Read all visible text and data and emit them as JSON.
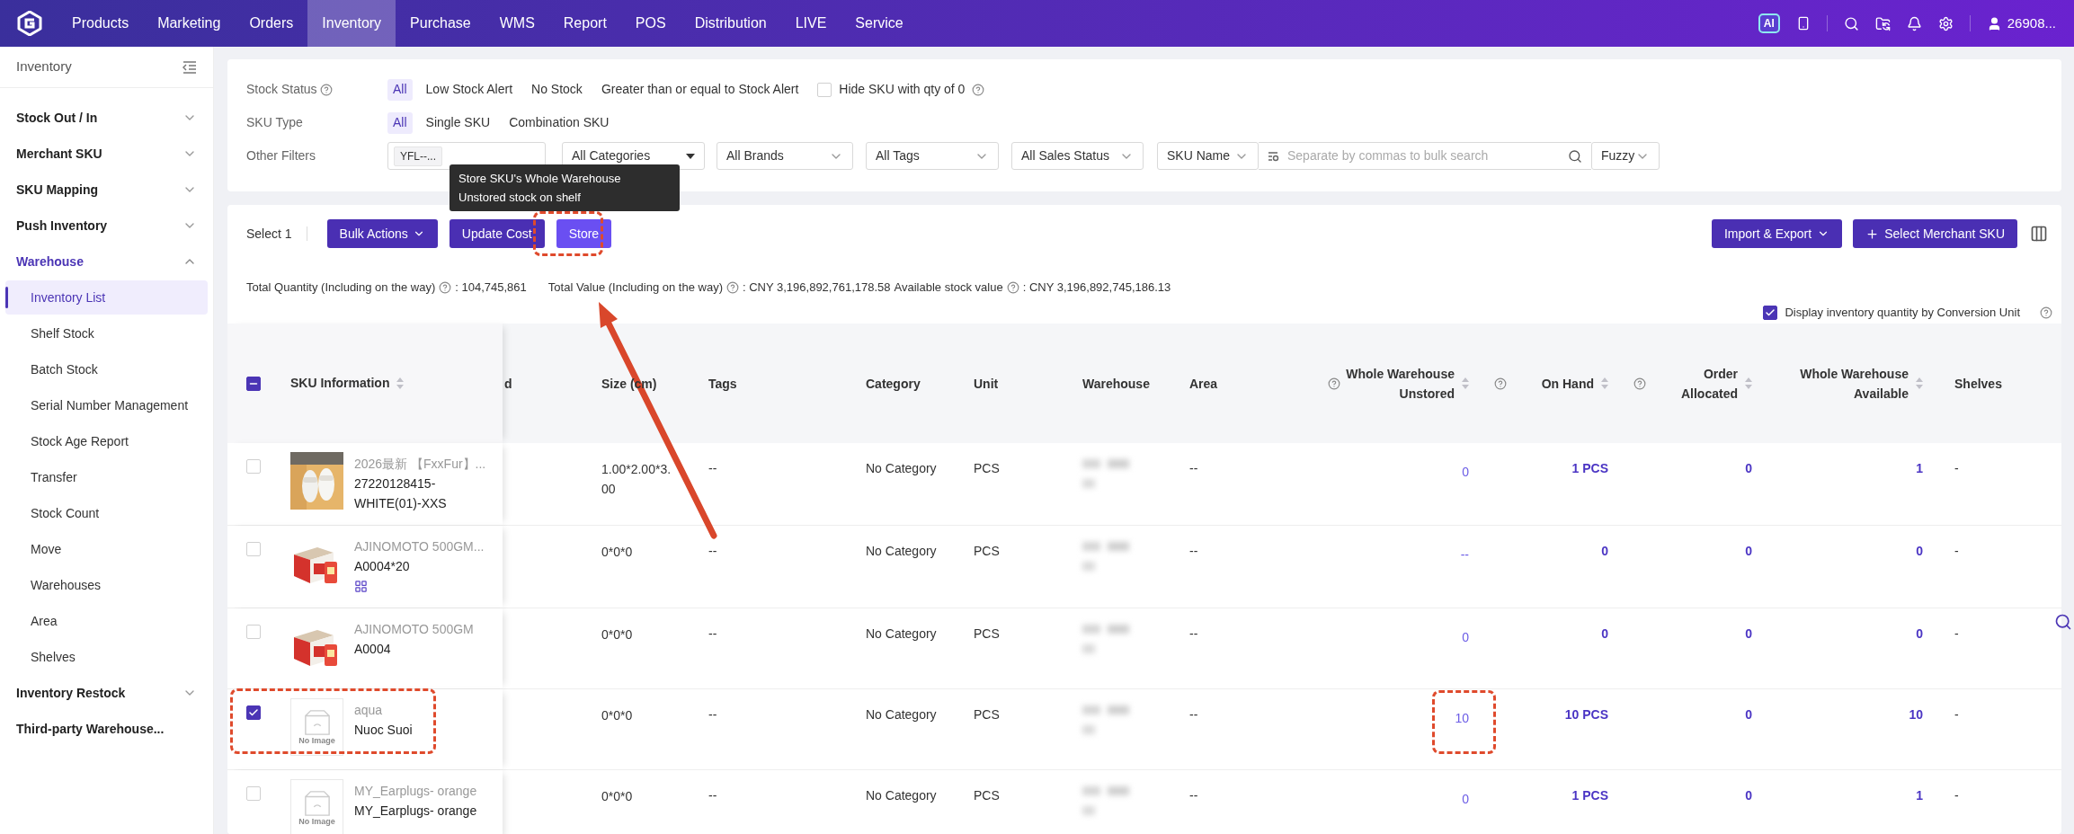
{
  "top_nav": {
    "items": [
      {
        "label": "Products",
        "selected": false
      },
      {
        "label": "Marketing",
        "selected": false
      },
      {
        "label": "Orders",
        "selected": false
      },
      {
        "label": "Inventory",
        "selected": true
      },
      {
        "label": "Purchase",
        "selected": false
      },
      {
        "label": "WMS",
        "selected": false
      },
      {
        "label": "Report",
        "selected": false
      },
      {
        "label": "POS",
        "selected": false
      },
      {
        "label": "Distribution",
        "selected": false
      },
      {
        "label": "LIVE",
        "selected": false
      },
      {
        "label": "Service",
        "selected": false
      }
    ],
    "ai_badge": "AI",
    "user": "26908..."
  },
  "sidebar": {
    "title": "Inventory",
    "groups": [
      {
        "label": "Stock Out / In",
        "expandable": true,
        "expanded": false,
        "selected": false
      },
      {
        "label": "Merchant SKU",
        "expandable": true,
        "expanded": false,
        "selected": false
      },
      {
        "label": "SKU Mapping",
        "expandable": true,
        "expanded": false,
        "selected": false
      },
      {
        "label": "Push Inventory",
        "expandable": true,
        "expanded": false,
        "selected": false
      },
      {
        "label": "Warehouse",
        "expandable": true,
        "expanded": true,
        "selected": true,
        "children": [
          {
            "label": "Inventory List",
            "selected": true
          },
          {
            "label": "Shelf Stock",
            "selected": false
          },
          {
            "label": "Batch Stock",
            "selected": false
          },
          {
            "label": "Serial Number Management",
            "selected": false
          },
          {
            "label": "Stock Age Report",
            "selected": false
          },
          {
            "label": "Transfer",
            "selected": false
          },
          {
            "label": "Stock Count",
            "selected": false
          },
          {
            "label": "Move",
            "selected": false
          },
          {
            "label": "Warehouses",
            "selected": false
          },
          {
            "label": "Area",
            "selected": false
          },
          {
            "label": "Shelves",
            "selected": false
          }
        ]
      },
      {
        "label": "Inventory Restock",
        "expandable": true,
        "expanded": false,
        "selected": false
      },
      {
        "label": "Third-party Warehouse...",
        "expandable": false,
        "expanded": false,
        "selected": false
      }
    ]
  },
  "filters": {
    "stock_status": {
      "label": "Stock Status",
      "options": [
        {
          "label": "All",
          "selected": true
        },
        {
          "label": "Low Stock Alert",
          "selected": false
        },
        {
          "label": "No Stock",
          "selected": false
        },
        {
          "label": "Greater than or equal to Stock Alert",
          "selected": false
        }
      ],
      "hide_zero": {
        "label": "Hide SKU with qty of 0",
        "checked": false
      }
    },
    "sku_type": {
      "label": "SKU Type",
      "options": [
        {
          "label": "All",
          "selected": true
        },
        {
          "label": "Single SKU",
          "selected": false
        },
        {
          "label": "Combination SKU",
          "selected": false
        }
      ]
    },
    "other": {
      "label": "Other Filters",
      "warehouse_tag": "YFL--...",
      "category": "All Categories",
      "brand": "All Brands",
      "tags": "All Tags",
      "sales_status": "All Sales Status",
      "search": {
        "field": "SKU Name",
        "placeholder": "Separate by commas to bulk search",
        "mode": "Fuzzy"
      }
    }
  },
  "tooltip": {
    "lines": [
      "Store SKU's Whole Warehouse",
      "Unstored stock on shelf"
    ]
  },
  "toolbar": {
    "selected_count": "Select 1",
    "buttons": [
      {
        "label": "Bulk Actions",
        "kind": "dropdown"
      },
      {
        "label": "Update Cost",
        "kind": "plain"
      },
      {
        "label": "Store",
        "kind": "highlight"
      }
    ],
    "right_buttons": [
      {
        "label": "Import & Export",
        "kind": "dropdown"
      },
      {
        "label": "Select Merchant SKU",
        "kind": "add"
      }
    ]
  },
  "totals": [
    {
      "label": "Total Quantity (Including on the way)",
      "value": ": 104,745,861"
    },
    {
      "label": "Total Value (Including on the way)",
      "value": ": CNY 3,196,892,761,178.58"
    },
    {
      "label": "Available stock value",
      "value": ": CNY 3,196,892,745,186.13"
    }
  ],
  "display_toggle": {
    "label": "Display inventory quantity by Conversion Unit",
    "checked": true
  },
  "table": {
    "select_all_indeterminate": true,
    "columns": [
      {
        "label": "SKU Information",
        "help": false,
        "sortable": true
      },
      {
        "label": "d",
        "help": false,
        "sortable": false
      },
      {
        "label": "Size (cm)",
        "help": false,
        "sortable": false
      },
      {
        "label": "Tags",
        "help": false,
        "sortable": false
      },
      {
        "label": "Category",
        "help": false,
        "sortable": false
      },
      {
        "label": "Unit",
        "help": false,
        "sortable": false
      },
      {
        "label": "Warehouse",
        "help": false,
        "sortable": false
      },
      {
        "label": "Area",
        "help": false,
        "sortable": false
      },
      {
        "label": "Whole Warehouse Unstored",
        "help": true,
        "sortable": true
      },
      {
        "label": "On Hand",
        "help": true,
        "sortable": true
      },
      {
        "label": "Order Allocated",
        "help": true,
        "sortable": true
      },
      {
        "label": "Whole Warehouse Available",
        "help": false,
        "sortable": true
      },
      {
        "label": "Shelves",
        "help": false,
        "sortable": false
      }
    ],
    "rows": [
      {
        "checked": false,
        "name": "2026最新 【FxxFur】...",
        "sku": "27220128415-WHITE(01)-XXS",
        "combo": false,
        "size": "1.00*2.00*3.00",
        "tags": "--",
        "category": "No Category",
        "unit": "PCS",
        "area": "--",
        "unstored": "0",
        "on_hand": "1 PCS",
        "allocated": "0",
        "available": "1",
        "shelves": "-"
      },
      {
        "checked": false,
        "name": "AJINOMOTO 500GM...",
        "sku": "A0004*20",
        "combo": true,
        "size": "0*0*0",
        "tags": "--",
        "category": "No Category",
        "unit": "PCS",
        "area": "--",
        "unstored": "--",
        "on_hand": "0",
        "allocated": "0",
        "available": "0",
        "shelves": "-"
      },
      {
        "checked": false,
        "name": "AJINOMOTO 500GM",
        "sku": "A0004",
        "combo": false,
        "size": "0*0*0",
        "tags": "--",
        "category": "No Category",
        "unit": "PCS",
        "area": "--",
        "unstored": "0",
        "on_hand": "0",
        "allocated": "0",
        "available": "0",
        "shelves": "-"
      },
      {
        "checked": true,
        "image": {
          "kind": "placeholder",
          "text": "No Image"
        },
        "name": "aqua",
        "sku": "Nuoc Suoi",
        "combo": false,
        "size": "0*0*0",
        "tags": "--",
        "category": "No Category",
        "unit": "PCS",
        "area": "--",
        "unstored": "10",
        "on_hand": "10 PCS",
        "allocated": "0",
        "available": "10",
        "shelves": "-"
      },
      {
        "checked": false,
        "image": {
          "kind": "placeholder",
          "text": "No Image"
        },
        "name": "MY_Earplugs- orange",
        "sku": "MY_Earplugs- orange",
        "combo": false,
        "size": "0*0*0",
        "tags": "--",
        "category": "No Category",
        "unit": "PCS",
        "area": "--",
        "unstored": "0",
        "on_hand": "1 PCS",
        "allocated": "0",
        "available": "1",
        "shelves": "-"
      }
    ]
  }
}
